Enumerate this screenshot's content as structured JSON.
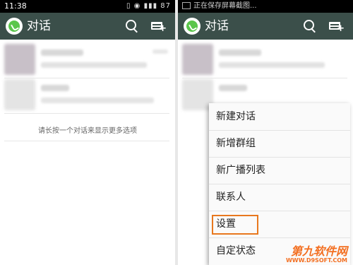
{
  "status_left": {
    "time": "11:38",
    "sys": "▯ ◉ ▮▮▮ 87"
  },
  "status_right": {
    "notification": "正在保存屏幕截图..."
  },
  "app": {
    "title": "对话"
  },
  "left": {
    "hint": "请长按一个对话来显示更多选项"
  },
  "menu": {
    "items": [
      "新建对话",
      "新增群组",
      "新广播列表",
      "联系人",
      "设置",
      "自定状态"
    ],
    "highlighted_index": 4,
    "highlight_color": "#e8781e"
  },
  "colors": {
    "actionbar": "#3b4f4a",
    "logo": "#5ac64b"
  },
  "watermark": {
    "line1": "第九软件网",
    "line2": "WWW.D9SOFT.COM"
  }
}
